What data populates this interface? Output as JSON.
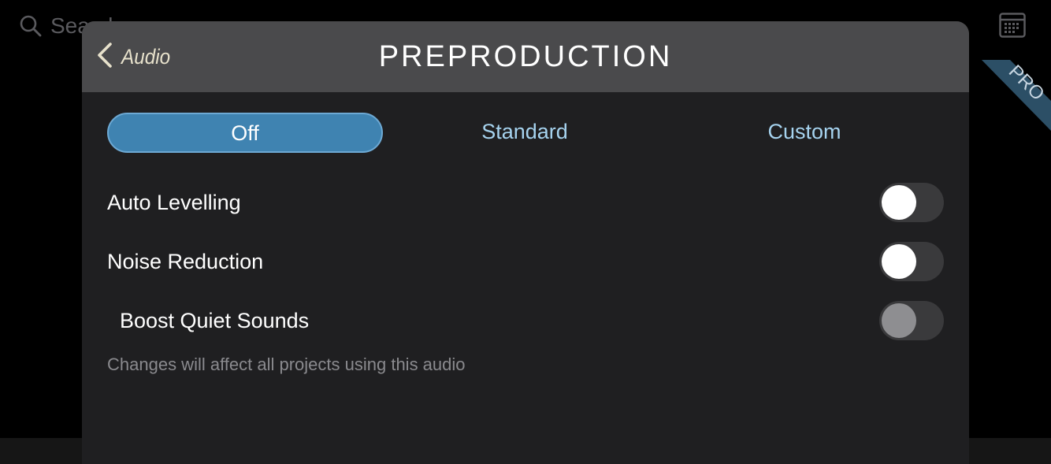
{
  "background": {
    "search_placeholder": "Search",
    "search_icon": "search-icon",
    "calendar_icon": "calendar-icon",
    "pro_badge": "PRO"
  },
  "header": {
    "back_label": "Audio",
    "back_icon": "chevron-left-icon",
    "title": "PREPRODUCTION"
  },
  "segments": [
    {
      "label": "Off",
      "selected": true
    },
    {
      "label": "Standard",
      "selected": false
    },
    {
      "label": "Custom",
      "selected": false
    }
  ],
  "settings": [
    {
      "label": "Auto Levelling",
      "enabled": true,
      "value": false
    },
    {
      "label": "Noise Reduction",
      "enabled": true,
      "value": false
    },
    {
      "label": "Boost Quiet Sounds",
      "enabled": false,
      "value": false
    }
  ],
  "footnote": "Changes will affect all projects using this audio",
  "colors": {
    "accent": "#3f83b1",
    "accent_text": "#a6d3ef",
    "header_bg": "#4a4a4c",
    "sheet_bg": "#1f1f21",
    "back_text": "#e8e2cc",
    "pro_ribbon": "#2c4f66"
  }
}
